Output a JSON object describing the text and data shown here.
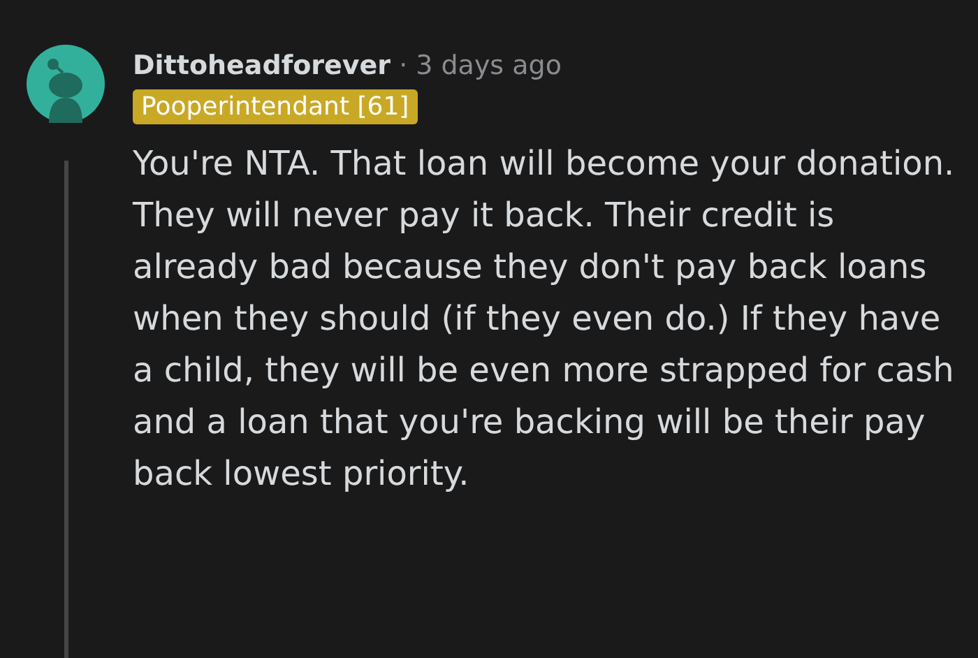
{
  "comment": {
    "author": "Dittoheadforever",
    "separator": "·",
    "time": "3 days ago",
    "flair": "Pooperintendant [61]",
    "body": "You're NTA. That loan will become your donation. They will never pay it back. Their credit is already bad because they don't pay back loans when they should (if they even do.) If they have a child, they will be even more strapped for cash and a loan that you're backing will be their pay back lowest priority."
  }
}
